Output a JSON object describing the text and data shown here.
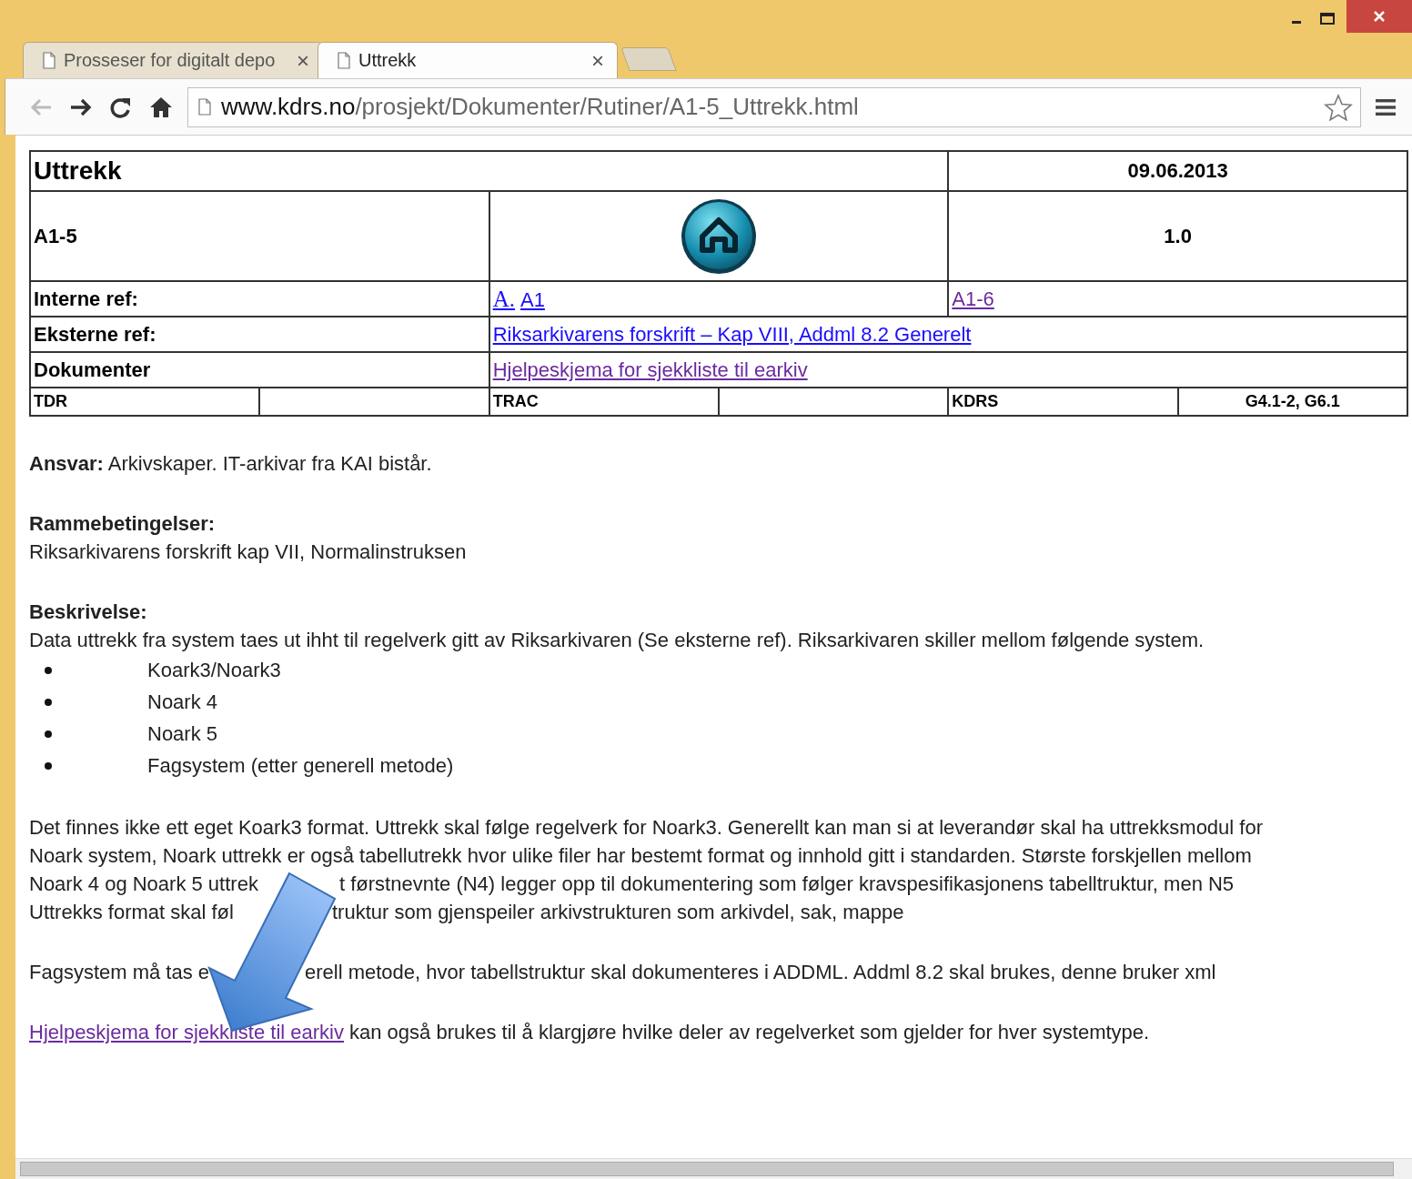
{
  "tabs": [
    {
      "title": "Prosseser for digitalt depo",
      "close": "×",
      "selected": false
    },
    {
      "title": "Uttrekk",
      "close": "×",
      "selected": true
    }
  ],
  "toolbar": {
    "back_disabled": true,
    "url_host": "www.kdrs.no",
    "url_path": "/prosjekt/Dokumenter/Rutiner/A1-5_Uttrekk.html"
  },
  "header_table": {
    "title": "Uttrekk",
    "date": "09.06.2013",
    "code": "A1-5",
    "version": "1.0",
    "ref_rows": [
      {
        "label": "Interne ref:",
        "links": [
          {
            "text": "A.",
            "visited": false,
            "kind": "serif"
          },
          {
            "text": "A1",
            "visited": false,
            "kind": "plain"
          }
        ],
        "right_links": [
          {
            "text": "A1-6",
            "visited": true,
            "kind": "plain"
          }
        ]
      },
      {
        "label": "Eksterne ref:",
        "links": [
          {
            "text": "Riksarkivarens forskrift – Kap VIII, Addml 8.2 Generelt",
            "visited": false,
            "kind": "plain"
          }
        ]
      },
      {
        "label": "Dokumenter",
        "links": [
          {
            "text": "Hjelpeskjema for sjekkliste til earkiv",
            "visited": true,
            "kind": "plain"
          }
        ]
      }
    ],
    "codes": [
      {
        "label": "TDR"
      },
      {
        "label": "TRAC"
      },
      {
        "label": "KDRS",
        "value": "G4.1-2, G6.1"
      }
    ]
  },
  "responsibility": "**Ansvar:** Arkivskaper. IT-arkivar fra KAI bistår.",
  "framework": {
    "heading": "Rammebetingelser:",
    "text": "Riksarkivarens forskrift kap VII, Normalinstruksen"
  },
  "description": {
    "heading": "Beskrivelse:",
    "text": "Data uttrekk fra system taes ut ihht til regelverk gitt av Riksarkivaren (Se eksterne ref). Riksarkivaren skiller mellom følgende system.",
    "bullets": [
      "Koark3/Noark3",
      "Noark 4",
      "Noark 5",
      "Fagsystem (etter generell metode)"
    ]
  },
  "paragraph_lines": [
    [
      "Det finnes ikke ett eget Koark3 format. Uttrekk skal følge regelverk for Noark3. Generellt kan man si at leverandør skal ha uttrekksmodul for"
    ],
    [
      "Noark system, Noark uttrekk er også tabellutrekk hvor ulike filer har bestemt format og innhold gitt i standarden. Største forskjellen mellom"
    ],
    [
      "Noark 4 og Noark 5 uttrek",
      "t førstnevnte (N4) legger opp til dokumentering som følger kravspesifikasjonens tabelltruktur, men N5"
    ],
    [
      "Uttrekks format skal føl",
      "truktur som gjenspeiler arkivstrukturen som arkivdel, sak, mappe"
    ]
  ],
  "fagsystem_line": [
    "Fagsystem må tas e",
    "erell metode, hvor tabellstruktur skal dokumenteres i ADDML. Addml 8.2 skal brukes, denne bruker xml"
  ],
  "closing": {
    "link": "Hjelpeskjema for sjekkliste til earkiv",
    "link_visited": true,
    "text": "kan også brukes til å klargjøre hvilke deler av regelverket som gjelder for hver systemtype."
  }
}
